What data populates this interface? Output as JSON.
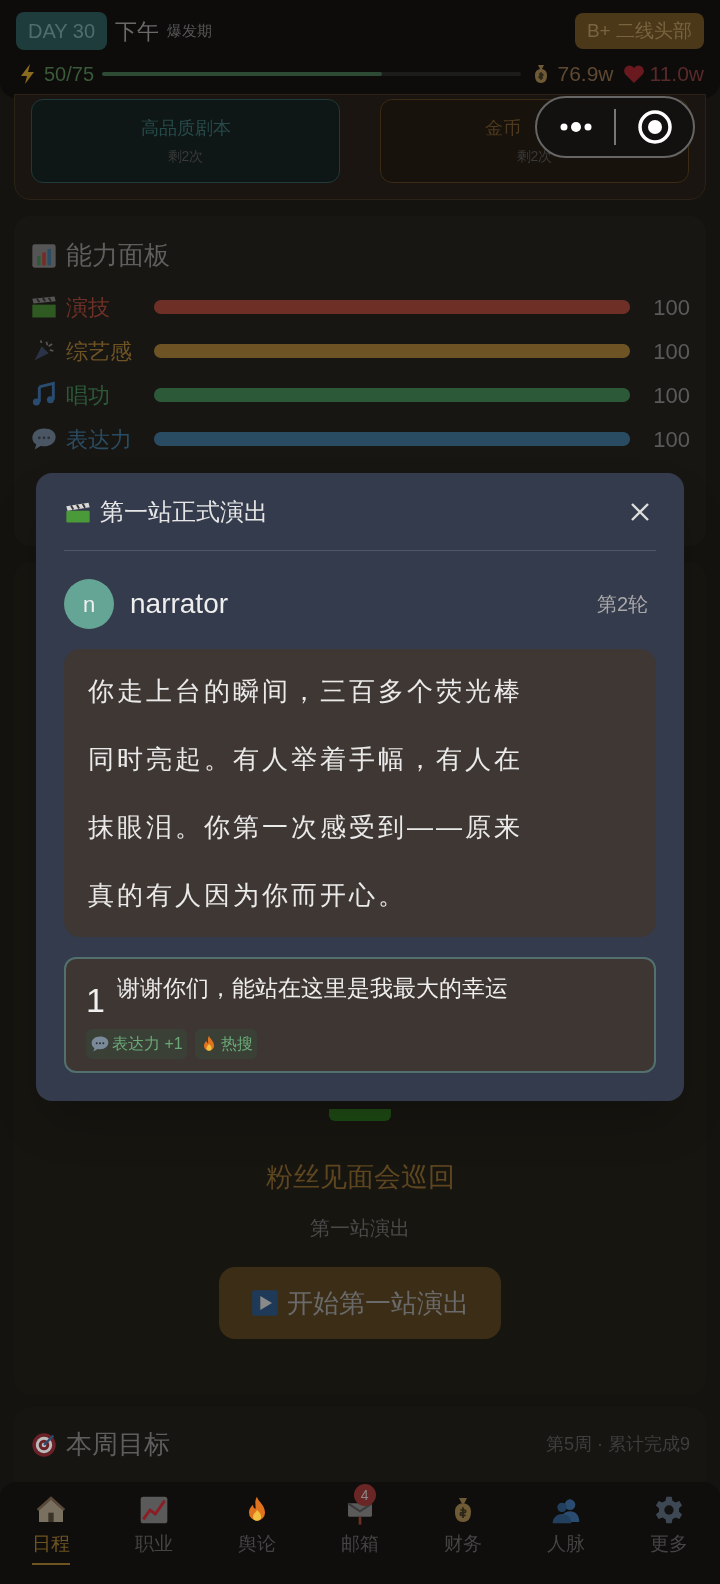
{
  "header": {
    "day": "DAY 30",
    "time": "下午",
    "phase": "爆发期",
    "rank": "B+ 二线头部",
    "energy": {
      "reading": "50/75",
      "level": 0.667
    },
    "money": "76.9w",
    "fans": "11.0w"
  },
  "resource_cards": [
    {
      "title": "高品质剧本",
      "remaining": "剩2次",
      "kind": "script"
    },
    {
      "title": "金币",
      "remaining": "剩2次",
      "kind": "coin"
    }
  ],
  "ability_panel": {
    "title": "能力面板",
    "abilities": [
      {
        "name": "演技",
        "kind": "acting",
        "level": 1,
        "reading": "100",
        "color": "#6e3026"
      },
      {
        "name": "综艺感",
        "kind": "variety",
        "level": 1,
        "reading": "100",
        "color": "#6e5424"
      },
      {
        "name": "唱功",
        "kind": "singing",
        "level": 1,
        "reading": "100",
        "color": "#2c5a38"
      },
      {
        "name": "表达力",
        "kind": "speech",
        "level": 1,
        "reading": "100",
        "color": "#2a4c62"
      }
    ]
  },
  "event": {
    "title": "粉丝见面会巡回",
    "subtitle": "第一站演出",
    "action": "开始第一站演出"
  },
  "weekly_goal": {
    "title": "本周目标",
    "progress": "第5周 · 累计完成9"
  },
  "nav": [
    {
      "label": "日程",
      "kind": "home",
      "selected": true
    },
    {
      "label": "职业",
      "kind": "chart",
      "selected": false
    },
    {
      "label": "舆论",
      "kind": "fire",
      "selected": false
    },
    {
      "label": "邮箱",
      "kind": "mail",
      "selected": false,
      "badge": "4"
    },
    {
      "label": "财务",
      "kind": "money",
      "selected": false
    },
    {
      "label": "人脉",
      "kind": "people",
      "selected": false
    },
    {
      "label": "更多",
      "kind": "gear",
      "selected": false
    }
  ],
  "dialog": {
    "title": "第一站正式演出",
    "speaker": {
      "initial": "n",
      "name": "narrator"
    },
    "round": "第2轮",
    "narration": "你走上台的瞬间，三百多个荧光棒同时亮起。有人举着手幅，有人在抹眼泪。你第一次感受到——原来真的有人因为你而开心。",
    "choices": [
      {
        "number": "1",
        "text": "谢谢你们，能站在这里是我最大的幸运",
        "tags": [
          {
            "text": "表达力 +1",
            "kind": "chat"
          },
          {
            "text": "热搜",
            "kind": "fire"
          }
        ]
      }
    ]
  }
}
